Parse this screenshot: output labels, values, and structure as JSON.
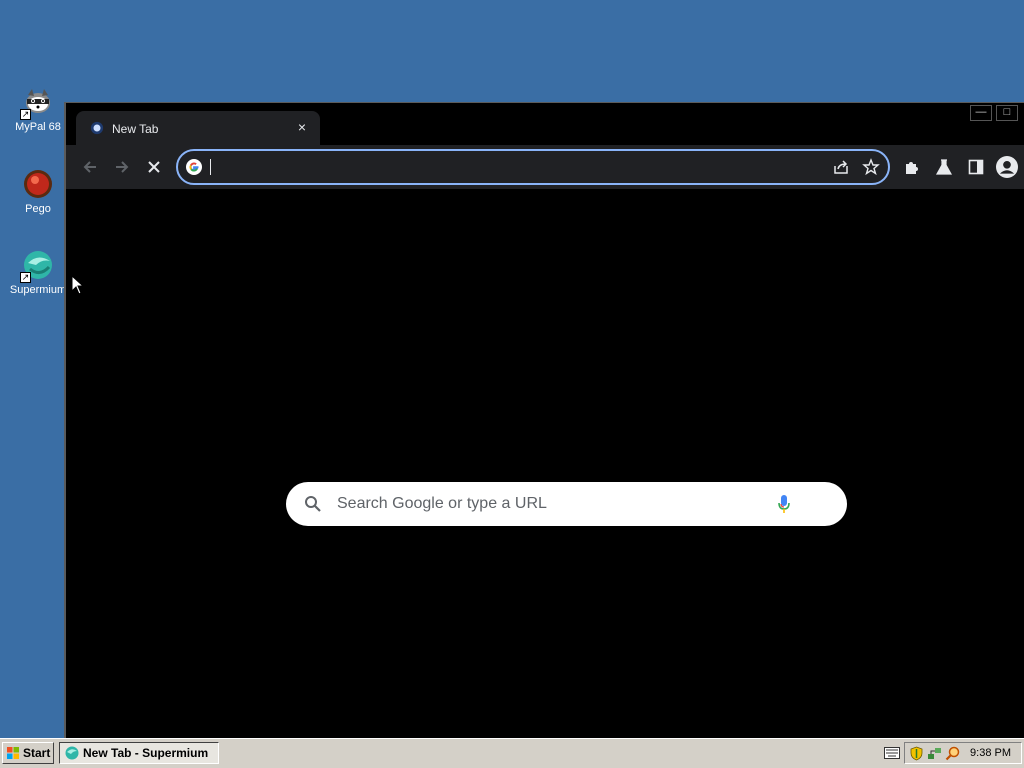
{
  "desktop": {
    "icons": [
      {
        "label": "MyPal 68",
        "icon": "raccoon-icon"
      },
      {
        "label": "Pego",
        "icon": "pego-icon"
      },
      {
        "label": "Supermium",
        "icon": "supermium-icon"
      }
    ]
  },
  "browser": {
    "tab": {
      "title": "New Tab",
      "close_glyph": "×"
    },
    "window_controls": {
      "minimize": "—",
      "maximize": "□"
    },
    "omnibox": {
      "value": "",
      "placeholder": ""
    },
    "search": {
      "placeholder": "Search Google or type a URL"
    },
    "accent_color": "#8ab4f8"
  },
  "taskbar": {
    "start_label": "Start",
    "task_label": "New Tab - Supermium",
    "clock": "9:38 PM"
  }
}
